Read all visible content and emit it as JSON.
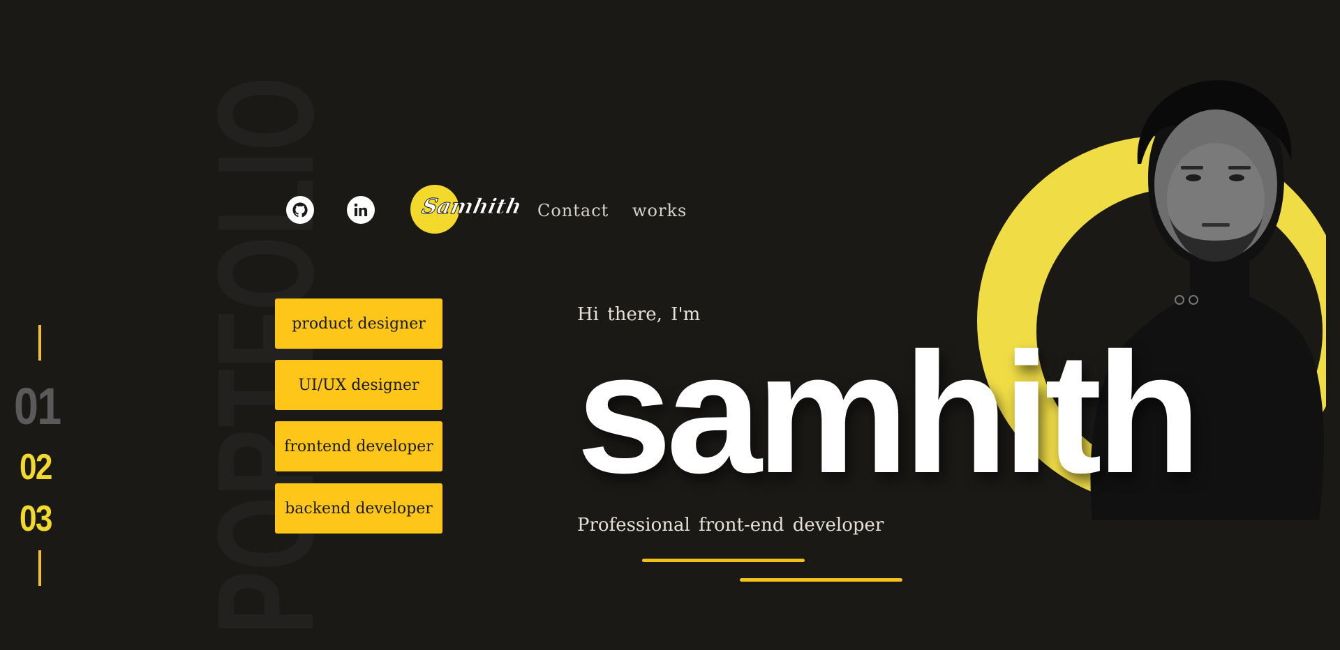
{
  "watermark": {
    "text": "PORTFOLIO"
  },
  "rail": {
    "numbers": [
      "01",
      "02",
      "03"
    ]
  },
  "nav": {
    "logo_text": "Samhith",
    "links": [
      "Contact",
      "works"
    ]
  },
  "roles": [
    "product designer",
    "UI/UX designer",
    "frontend developer",
    "backend developer"
  ],
  "hero": {
    "greeting": "Hi there, I'm",
    "name": "samhith",
    "subtitle": "Professional front-end developer"
  },
  "colors": {
    "background": "#1b1916",
    "accent": "#f2c21b",
    "button": "#fec619",
    "circle": "#f2d92c"
  },
  "icons": [
    "github-icon",
    "linkedin-icon"
  ]
}
